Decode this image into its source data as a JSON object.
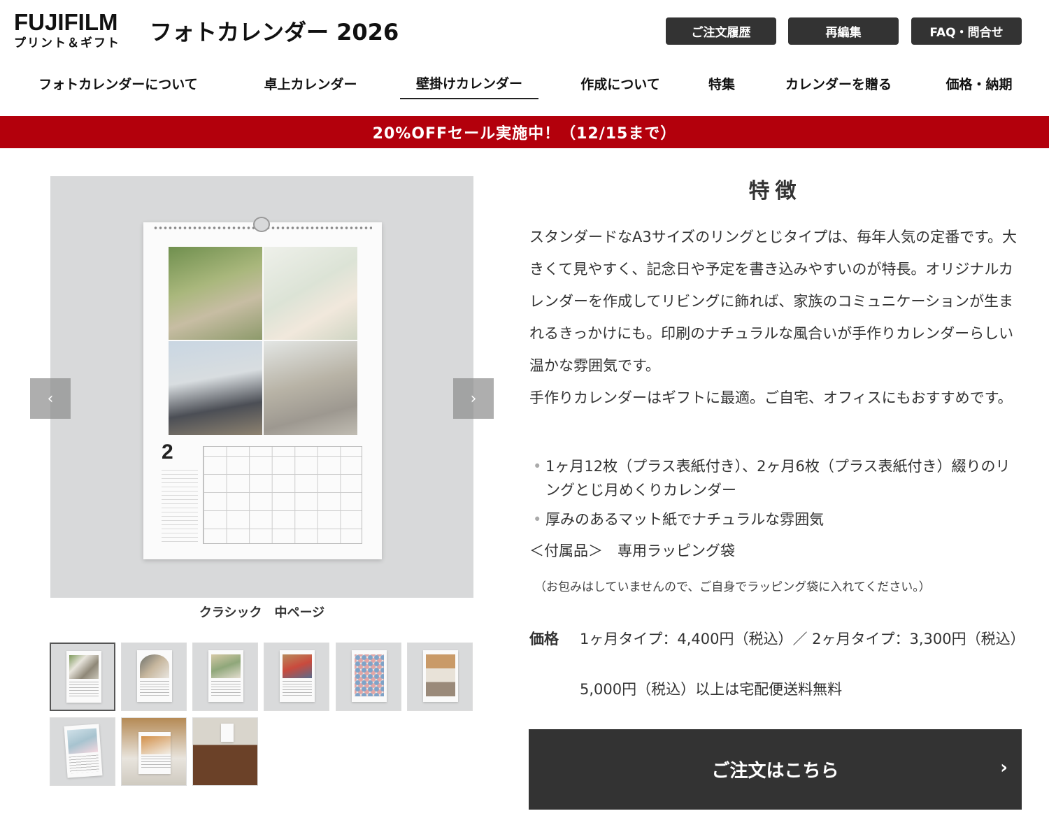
{
  "header": {
    "logo_main": "FUJIFILM",
    "logo_sub": "プリント＆ギフト",
    "site_title": "フォトカレンダー 2026",
    "buttons": [
      "ご注文履歴",
      "再編集",
      "FAQ・問合せ"
    ]
  },
  "nav": {
    "items": [
      "フォトカレンダーについて",
      "卓上カレンダー",
      "壁掛けカレンダー",
      "作成について",
      "特集",
      "カレンダーを贈る",
      "価格・納期"
    ],
    "active_index": 2
  },
  "sale_banner": "20%OFFセール実施中！（12/15まで）",
  "gallery": {
    "calendar_month": "2",
    "caption": "クラシック　中ページ",
    "prev_icon": "‹",
    "next_icon": "›",
    "thumbnail_count": 9,
    "selected_index": 0
  },
  "features": {
    "title": "特徴",
    "description_1": "スタンダードなA3サイズのリングとじタイプは、毎年人気の定番です。大きくて見やすく、記念日や予定を書き込みやすいのが特長。オリジナルカレンダーを作成してリビングに飾れば、家族のコミュニケーションが生まれるきっかけにも。印刷のナチュラルな風合いが手作りカレンダーらしい温かな雰囲気です。",
    "description_2": "手作りカレンダーはギフトに最適。ご自宅、オフィスにもおすすめです。",
    "bullets": [
      "1ヶ月12枚（プラス表紙付き）、2ヶ月6枚（プラス表紙付き）綴りのリングとじ月めくりカレンダー",
      "厚みのあるマット紙でナチュラルな雰囲気"
    ],
    "accessory": "＜付属品＞　専用ラッピング袋",
    "note": "（お包みはしていませんので、ご自身でラッピング袋に入れてください。）"
  },
  "price": {
    "label": "価格",
    "text": "1ヶ月タイプ：4,400円（税込）／ 2ヶ月タイプ：3,300円（税込）",
    "shipping": "5,000円（税込）以上は宅配便送料無料"
  },
  "order_button": {
    "label": "ご注文はこちら",
    "icon": "›"
  },
  "colors": {
    "sale_red": "#b3000c",
    "dark_button": "#333333",
    "logo_accent": "#e30000"
  }
}
